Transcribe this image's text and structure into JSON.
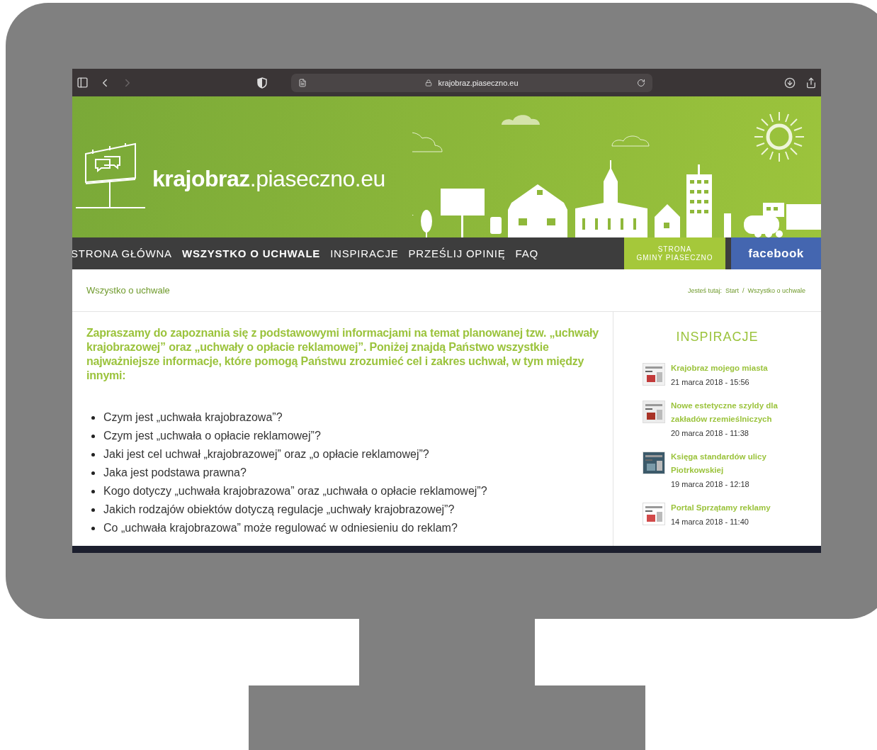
{
  "browser": {
    "url": "krajobraz.piaseczno.eu"
  },
  "banner": {
    "site_name": "**krajobraz**.piaseczno.eu"
  },
  "nav": {
    "items": [
      {
        "label": "STRONA GŁÓWNA",
        "selected": false
      },
      {
        "label": "WSZYSTKO O UCHWALE",
        "selected": true
      },
      {
        "label": "INSPIRACJE",
        "selected": false
      },
      {
        "label": "PRZEŚLIJ OPINIĘ",
        "selected": false
      },
      {
        "label": "FAQ",
        "selected": false
      }
    ],
    "municipality_link": "STRONA\nGMINY PIASECZNO",
    "facebook_link": "facebook"
  },
  "breadcrumb": {
    "page_title": "Wszystko o uchwale",
    "trail_label": "Jesteś tutaj:",
    "crumbs": [
      "Start",
      "Wszystko o uchwale"
    ],
    "separator": "/"
  },
  "article": {
    "intro": "Zapraszamy do zapoznania się z podstawowymi informacjami na temat planowanej tzw. „uchwały krajobrazowej” oraz „uchwały o opłacie reklamowej”. Poniżej znajdą Państwo wszystkie najważniejsze informacje, które pomogą Państwu zrozumieć cel i zakres uchwał, w tym między innymi:",
    "questions": [
      "Czym jest „uchwała krajobrazowa”?",
      "Czym jest „uchwała o opłacie reklamowej”?",
      "Jaki jest cel uchwał „krajobrazowej” oraz „o opłacie reklamowej”?",
      "Jaka jest podstawa prawna?",
      "Kogo dotyczy „uchwała krajobrazowa” oraz „uchwała o opłacie reklamowej”?",
      "Jakich rodzajów obiektów dotyczą regulacje „uchwały krajobrazowej”?",
      "Co „uchwała krajobrazowa” może regulować w odniesieniu do reklam?"
    ]
  },
  "sidebar": {
    "title": "INSPIRACJE",
    "posts": [
      {
        "title": "Krajobraz mojego miasta",
        "date": "21 marca 2018 - 15:56"
      },
      {
        "title": "Nowe estetyczne szyldy dla zakładów rzemieślniczych",
        "date": "20 marca 2018 - 11:38"
      },
      {
        "title": "Księga standardów ulicy Piotrkowskiej",
        "date": "19 marca 2018 - 12:18"
      },
      {
        "title": "Portal Sprzątamy reklamy",
        "date": "14 marca 2018 - 11:40"
      }
    ]
  }
}
